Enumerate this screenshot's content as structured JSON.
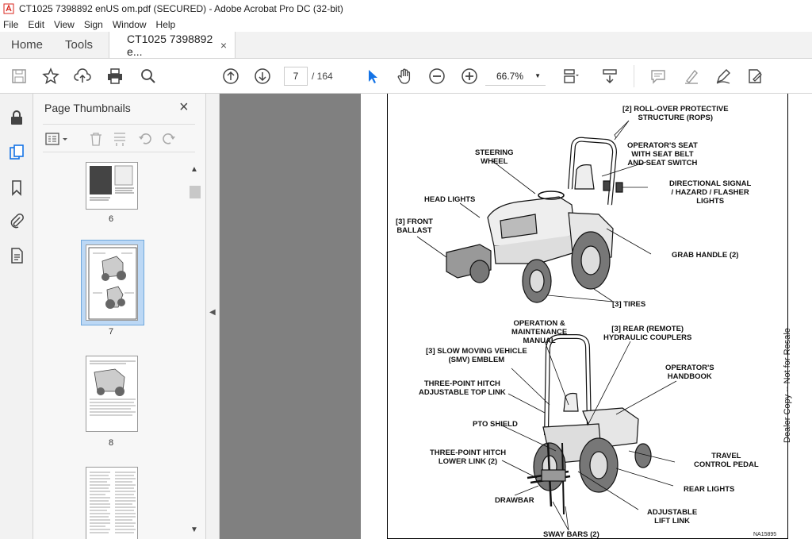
{
  "window": {
    "title": "CT1025 7398892 enUS om.pdf (SECURED) - Adobe Acrobat Pro DC (32-bit)"
  },
  "menu": [
    "File",
    "Edit",
    "View",
    "Sign",
    "Window",
    "Help"
  ],
  "tabs": {
    "home": "Home",
    "tools": "Tools",
    "document": "CT1025 7398892 e...",
    "close": "×"
  },
  "toolbar": {
    "current_page": "7",
    "page_separator": "/ 164",
    "zoom": "66.7%"
  },
  "thumbnails_panel": {
    "title": "Page Thumbnails",
    "close": "×",
    "pages": [
      {
        "label": "6",
        "selected": false
      },
      {
        "label": "7",
        "selected": true
      },
      {
        "label": "8",
        "selected": false
      },
      {
        "label": "",
        "selected": false
      }
    ]
  },
  "document_page": {
    "callouts": {
      "rops": "[2] ROLL-OVER PROTECTIVE\nSTRUCTURE (ROPS)",
      "seat": "OPERATOR'S SEAT\nWITH SEAT BELT\nAND SEAT SWITCH",
      "steering": "STEERING\nWHEEL",
      "signal": "DIRECTIONAL SIGNAL\n/ HAZARD / FLASHER\nLIGHTS",
      "headlights": "HEAD LIGHTS",
      "ballast": "[3] FRONT\nBALLAST",
      "grab": "GRAB HANDLE (2)",
      "tires": "[3] TIRES",
      "manual": "OPERATION &\nMAINTENANCE\nMANUAL",
      "couplers": "[3] REAR (REMOTE)\nHYDRAULIC COUPLERS",
      "smv": "[3] SLOW MOVING VEHICLE\n(SMV) EMBLEM",
      "handbook": "OPERATOR'S\nHANDBOOK",
      "toplink": "THREE-POINT HITCH\nADJUSTABLE TOP LINK",
      "pto": "PTO SHIELD",
      "travel": "TRAVEL\nCONTROL PEDAL",
      "lowerlink": "THREE-POINT HITCH\nLOWER LINK (2)",
      "rearlights": "REAR LIGHTS",
      "drawbar": "DRAWBAR",
      "liftlink": "ADJUSTABLE\nLIFT LINK",
      "swaybars": "SWAY BARS (2)"
    },
    "figure_code": "NA15895",
    "watermark": "Dealer Copy -- Not for Resale"
  },
  "colors": {
    "accent": "#1473e6",
    "doc_background": "#808080",
    "title_icon": "#d9261c"
  }
}
